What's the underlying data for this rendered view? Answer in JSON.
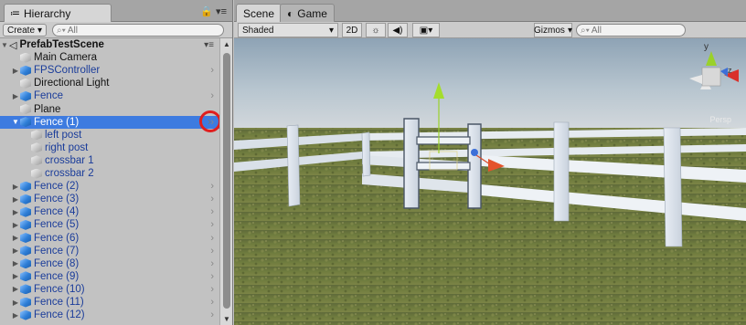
{
  "hierarchy": {
    "tab_label": "Hierarchy",
    "tab_icon": "list-icon",
    "create_label": "Create",
    "search_placeholder": "All",
    "scene_name": "PrefabTestScene",
    "items": [
      {
        "label": "Main Camera",
        "icon": "cube-grey",
        "style": "black",
        "arrow": "",
        "chevron": false
      },
      {
        "label": "FPSController",
        "icon": "cube-blue",
        "style": "prefab",
        "arrow": "collapsed",
        "chevron": true
      },
      {
        "label": "Directional Light",
        "icon": "cube-grey",
        "style": "black",
        "arrow": "",
        "chevron": false
      },
      {
        "label": "Fence",
        "icon": "cube-blue",
        "style": "prefab",
        "arrow": "collapsed",
        "chevron": true
      },
      {
        "label": "Plane",
        "icon": "cube-grey",
        "style": "black",
        "arrow": "",
        "chevron": false
      },
      {
        "label": "Fence (1)",
        "icon": "cube-blue",
        "style": "prefab",
        "arrow": "expanded",
        "chevron": true,
        "selected": true
      },
      {
        "label": "left post",
        "icon": "cube-grey",
        "style": "prefab",
        "arrow": "",
        "chevron": false,
        "indent": 2
      },
      {
        "label": "right post",
        "icon": "cube-grey",
        "style": "prefab",
        "arrow": "",
        "chevron": false,
        "indent": 2
      },
      {
        "label": "crossbar 1",
        "icon": "cube-grey",
        "style": "prefab",
        "arrow": "",
        "chevron": false,
        "indent": 2
      },
      {
        "label": "crossbar 2",
        "icon": "cube-grey",
        "style": "prefab",
        "arrow": "",
        "chevron": false,
        "indent": 2
      },
      {
        "label": "Fence (2)",
        "icon": "cube-blue",
        "style": "prefab",
        "arrow": "collapsed",
        "chevron": true
      },
      {
        "label": "Fence (3)",
        "icon": "cube-blue",
        "style": "prefab",
        "arrow": "collapsed",
        "chevron": true
      },
      {
        "label": "Fence (4)",
        "icon": "cube-blue",
        "style": "prefab",
        "arrow": "collapsed",
        "chevron": true
      },
      {
        "label": "Fence (5)",
        "icon": "cube-blue",
        "style": "prefab",
        "arrow": "collapsed",
        "chevron": true
      },
      {
        "label": "Fence (6)",
        "icon": "cube-blue",
        "style": "prefab",
        "arrow": "collapsed",
        "chevron": true
      },
      {
        "label": "Fence (7)",
        "icon": "cube-blue",
        "style": "prefab",
        "arrow": "collapsed",
        "chevron": true
      },
      {
        "label": "Fence (8)",
        "icon": "cube-blue",
        "style": "prefab",
        "arrow": "collapsed",
        "chevron": true
      },
      {
        "label": "Fence (9)",
        "icon": "cube-blue",
        "style": "prefab",
        "arrow": "collapsed",
        "chevron": true
      },
      {
        "label": "Fence (10)",
        "icon": "cube-blue",
        "style": "prefab",
        "arrow": "collapsed",
        "chevron": true
      },
      {
        "label": "Fence (11)",
        "icon": "cube-blue",
        "style": "prefab",
        "arrow": "collapsed",
        "chevron": true
      },
      {
        "label": "Fence (12)",
        "icon": "cube-blue",
        "style": "prefab",
        "arrow": "collapsed",
        "chevron": true
      }
    ]
  },
  "scene_view": {
    "tab_scene": "Scene",
    "tab_game": "Game",
    "shading_mode": "Shaded",
    "mode_2d": "2D",
    "gizmos_label": "Gizmos",
    "search_placeholder": "All",
    "persp_label": "Persp",
    "axis_y": "y",
    "axis_z": "z"
  },
  "colors": {
    "selection": "#3d7be0",
    "prefab_text": "#1a3c9a",
    "highlight_circle": "#e01e1e",
    "sky_top": "#9fb3c2",
    "ground": "#6e7a3c"
  }
}
